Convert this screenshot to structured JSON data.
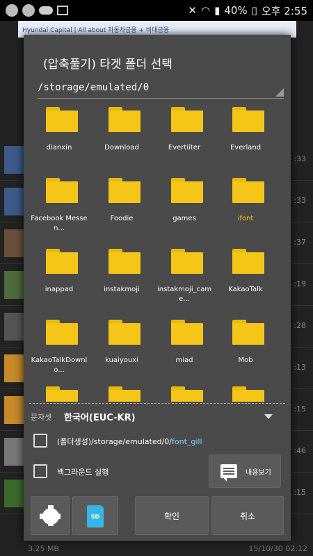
{
  "status_bar": {
    "signal": "40%",
    "clock": "오후 2:55",
    "icons": [
      "u-plus-icon",
      "talk-icon",
      "cloud-icon",
      "image-icon",
      "mute-icon",
      "wifi-icon",
      "signal-icon",
      "battery-icon"
    ]
  },
  "background": {
    "ad_text": "Hyundai Capital | All about 자동차금융 + 비대금융",
    "row_times": [
      ":33",
      ":33",
      ":37",
      ":19",
      ":28",
      ":13",
      ":15",
      ":46",
      ":15"
    ],
    "footer_size": "3.25 MB",
    "footer_date": "15/10/30 02:12"
  },
  "dialog": {
    "title": "(압축풀기) 타겟 폴더 선택",
    "path": "/storage/emulated/0",
    "folders": [
      {
        "name": "dianxin",
        "highlight": false
      },
      {
        "name": "Download",
        "highlight": false
      },
      {
        "name": "Evertiiter",
        "highlight": false
      },
      {
        "name": "Everland",
        "highlight": false
      },
      {
        "name": "Facebook Messen...",
        "highlight": false
      },
      {
        "name": "Foodie",
        "highlight": false
      },
      {
        "name": "games",
        "highlight": false
      },
      {
        "name": "ifont",
        "highlight": true
      },
      {
        "name": "inappad",
        "highlight": false
      },
      {
        "name": "instakmoji",
        "highlight": false
      },
      {
        "name": "instakmoji_came...",
        "highlight": false
      },
      {
        "name": "KakaoTalk",
        "highlight": false
      },
      {
        "name": "KakaoTalkDownlo...",
        "highlight": false
      },
      {
        "name": "kuaiyouxi",
        "highlight": false
      },
      {
        "name": "miad",
        "highlight": false
      },
      {
        "name": "Mob",
        "highlight": false
      },
      {
        "name": "",
        "highlight": false
      },
      {
        "name": "",
        "highlight": false
      },
      {
        "name": "",
        "highlight": false
      },
      {
        "name": "",
        "highlight": false
      }
    ],
    "charset_label": "문자셋",
    "charset_value": "한국어(EUC-KR)",
    "create_folder_prefix": "(폴더생성)/storage/emulated/0/",
    "create_folder_name": "font_gill",
    "background_run_label": "백그라운드 실행",
    "message_view_label": "내용보기",
    "ok_label": "확인",
    "cancel_label": "취소",
    "sd_label": "SD"
  },
  "colors": {
    "folder": "#f5c518",
    "dialog_bg": "#4a4a4a",
    "accent": "#7fd4ff"
  }
}
